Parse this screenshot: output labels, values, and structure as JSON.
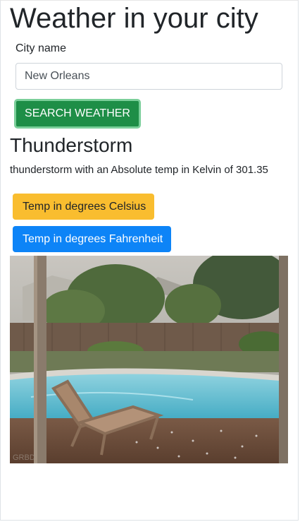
{
  "header": {
    "title": "Weather in your city"
  },
  "form": {
    "city_label": "City name",
    "city_value": "New Orleans",
    "search_label": "SEARCH WEATHER",
    "search_color": "#1e8e47"
  },
  "result": {
    "condition": "Thunderstorm",
    "description": "thunderstorm with an Absolute temp in Kelvin of 301.35",
    "celsius_label": "Temp in degrees Celsius",
    "celsius_color": "#f9bd2f",
    "fahrenheit_label": "Temp in degrees Fahrenheit",
    "fahrenheit_color": "#0d84f7"
  },
  "image": {
    "subject": "hailstorm over backyard pool with lounge chair",
    "watermark": "GRBD"
  }
}
